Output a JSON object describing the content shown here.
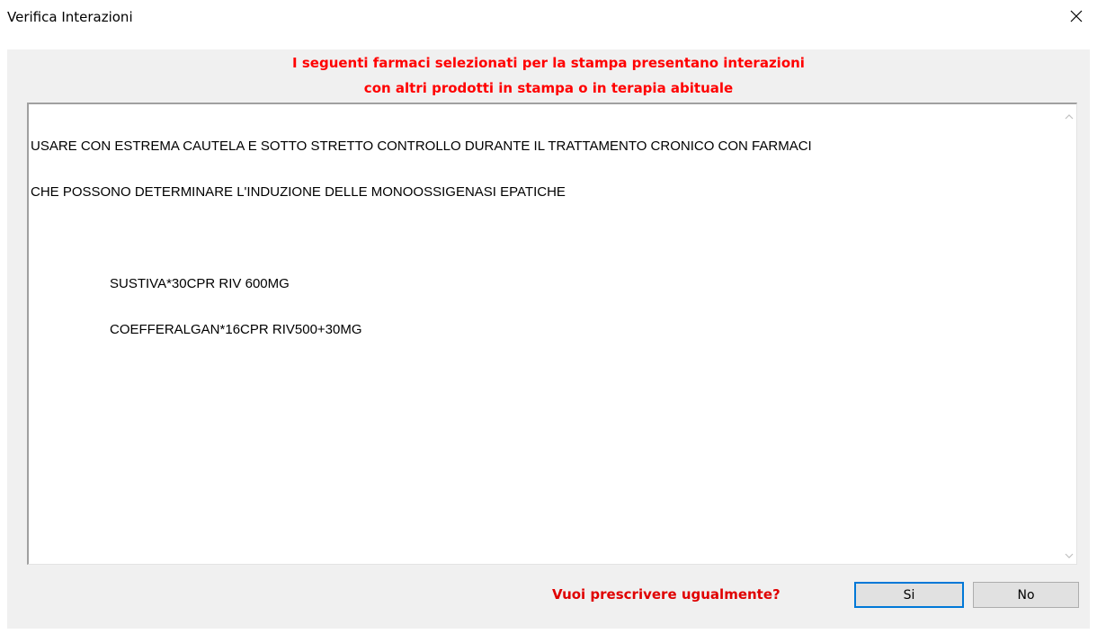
{
  "window": {
    "title": "Verifica Interazioni",
    "close_icon": "close-icon"
  },
  "header": {
    "line1": "I seguenti farmaci selezionati per la stampa presentano interazioni",
    "line2": "con altri prodotti in stampa o in terapia abituale",
    "color": "#ff0000"
  },
  "message": {
    "line1": "USARE CON ESTREMA CAUTELA E SOTTO STRETTO CONTROLLO DURANTE IL TRATTAMENTO CRONICO CON FARMACI",
    "line2": "CHE POSSONO DETERMINARE L'INDUZIONE DELLE MONOOSSIGENASI EPATICHE",
    "drugs": [
      "SUSTIVA*30CPR RIV 600MG",
      "COEFFERALGAN*16CPR RIV500+30MG"
    ]
  },
  "footer": {
    "question": "Vuoi prescrivere ugualmente?",
    "yes_label": "Si",
    "no_label": "No",
    "accent": "#0078d7"
  }
}
